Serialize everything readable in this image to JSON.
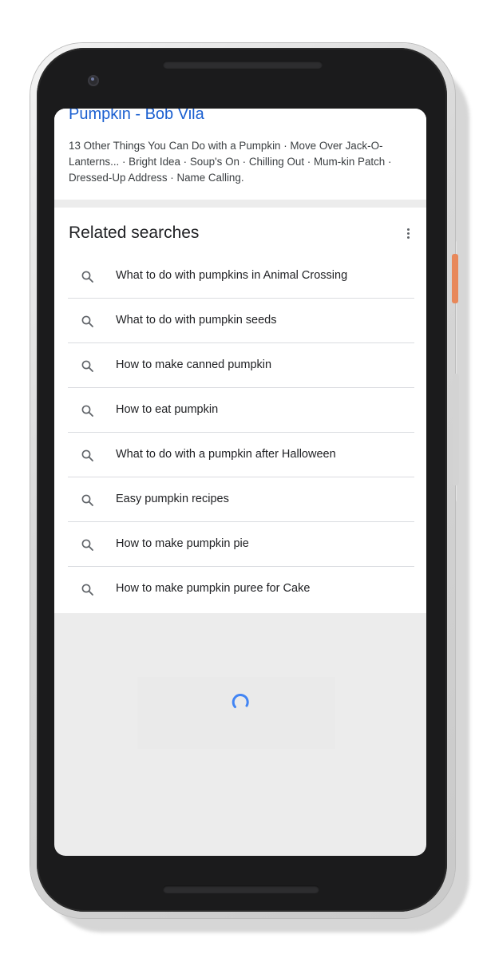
{
  "result": {
    "title": "Pumpkin - Bob Vila",
    "snippet": "13 Other Things You Can Do with a Pumpkin · Move Over Jack-O-Lanterns... · Bright Idea · Soup's On · Chilling Out · Mum-kin Patch · Dressed-Up Address · Name Calling."
  },
  "related": {
    "heading": "Related searches",
    "items": [
      {
        "label": "What to do with pumpkins in Animal Crossing",
        "icon": "search-icon"
      },
      {
        "label": "What to do with pumpkin seeds",
        "icon": "search-icon"
      },
      {
        "label": "How to make canned pumpkin",
        "icon": "search-icon"
      },
      {
        "label": "How to eat pumpkin",
        "icon": "search-icon"
      },
      {
        "label": "What to do with a pumpkin after Halloween",
        "icon": "search-icon"
      },
      {
        "label": "Easy pumpkin recipes",
        "icon": "search-icon"
      },
      {
        "label": "How to make pumpkin pie",
        "icon": "search-icon"
      },
      {
        "label": "How to make pumpkin puree for Cake",
        "icon": "search-icon"
      }
    ]
  },
  "colors": {
    "link": "#1a5fd0",
    "spinner": "#4285f4",
    "accent_button": "#e8885a"
  }
}
